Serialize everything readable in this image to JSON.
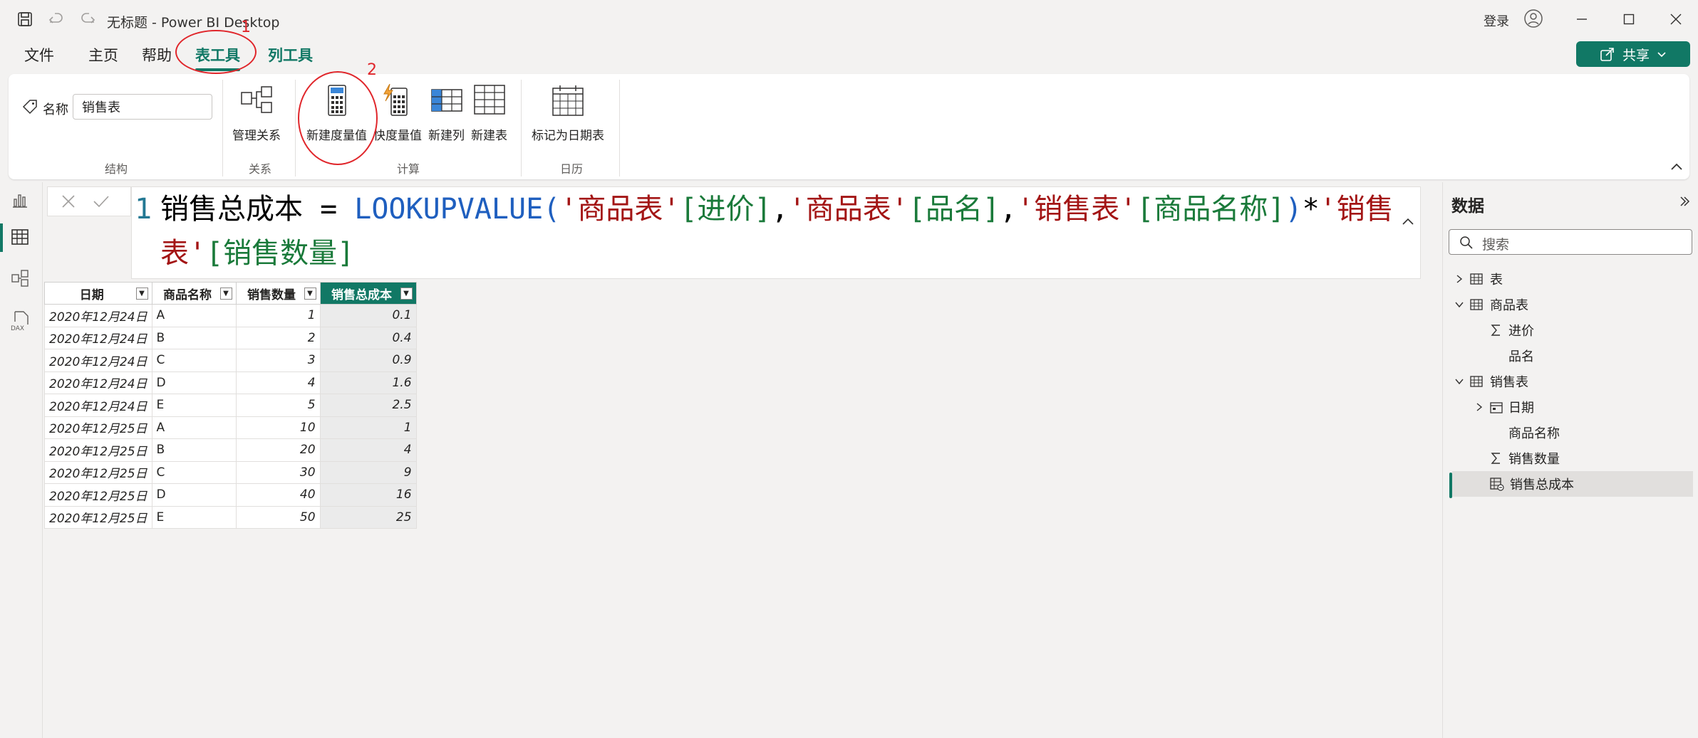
{
  "window": {
    "title": "无标题 - Power BI Desktop",
    "signin": "登录"
  },
  "menu": {
    "file": "文件",
    "home": "主页",
    "help": "帮助",
    "table_tools": "表工具",
    "column_tools": "列工具",
    "share": "共享"
  },
  "annotations": {
    "n1": "1",
    "n2": "2"
  },
  "ribbon": {
    "name_label": "名称",
    "name_value": "销售表",
    "groups": {
      "structure": "结构",
      "relations": "关系",
      "calc": "计算",
      "calendar": "日历"
    },
    "buttons": {
      "manage_relations": "管理关系",
      "new_measure": "新建度量值",
      "quick_measure": "快度量值",
      "new_column": "新建列",
      "new_table": "新建表",
      "mark_date_table": "标记为日期表"
    }
  },
  "formula": {
    "line_no": "1",
    "name": "销售总成本",
    "eq": " = ",
    "fn": "LOOKUPVALUE",
    "open": "(",
    "t1": "'商品表'",
    "c1": "[进价]",
    "comma1": ",",
    "t2": "'商品表'",
    "c2": "[品名]",
    "comma2": ",",
    "t3": "'销售表'",
    "c3": "[商品名称]",
    "close": ")",
    "star": "*",
    "t4": "'销售表'",
    "c4": "[销售数量]"
  },
  "table": {
    "headers": [
      "日期",
      "商品名称",
      "销售数量",
      "销售总成本"
    ],
    "rows": [
      [
        "2020年12月24日",
        "A",
        "1",
        "0.1"
      ],
      [
        "2020年12月24日",
        "B",
        "2",
        "0.4"
      ],
      [
        "2020年12月24日",
        "C",
        "3",
        "0.9"
      ],
      [
        "2020年12月24日",
        "D",
        "4",
        "1.6"
      ],
      [
        "2020年12月24日",
        "E",
        "5",
        "2.5"
      ],
      [
        "2020年12月25日",
        "A",
        "10",
        "1"
      ],
      [
        "2020年12月25日",
        "B",
        "20",
        "4"
      ],
      [
        "2020年12月25日",
        "C",
        "30",
        "9"
      ],
      [
        "2020年12月25日",
        "D",
        "40",
        "16"
      ],
      [
        "2020年12月25日",
        "E",
        "50",
        "25"
      ]
    ]
  },
  "data_pane": {
    "title": "数据",
    "search_placeholder": "搜索",
    "items": [
      {
        "label": "表",
        "icon": "table-icon"
      },
      {
        "label": "商品表",
        "icon": "table-icon"
      },
      {
        "label": "进价",
        "icon": "sigma-icon"
      },
      {
        "label": "品名",
        "icon": ""
      },
      {
        "label": "销售表",
        "icon": "table-icon"
      },
      {
        "label": "日期",
        "icon": "calendar-icon"
      },
      {
        "label": "商品名称",
        "icon": ""
      },
      {
        "label": "销售数量",
        "icon": "sigma-icon"
      },
      {
        "label": "销售总成本",
        "icon": "calculated-column-icon"
      }
    ]
  },
  "colors": {
    "accent": "#117865",
    "annotation": "#e0262b"
  }
}
